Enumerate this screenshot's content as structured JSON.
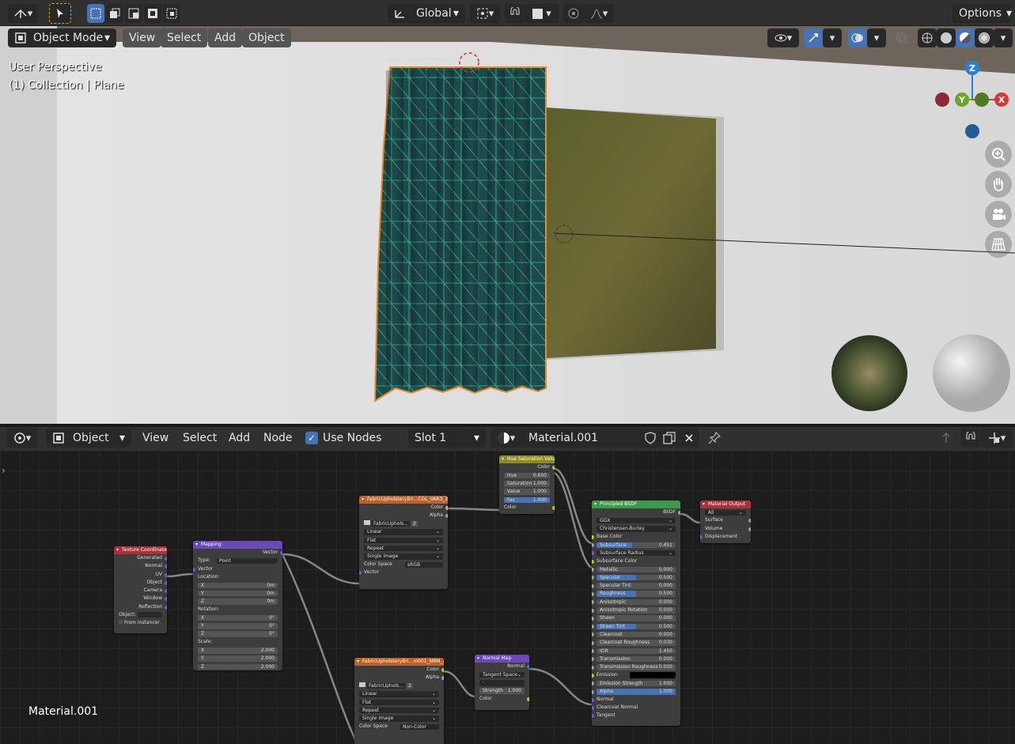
{
  "header": {
    "orientation": "Global",
    "options": "Options"
  },
  "viewport": {
    "mode": "Object Mode",
    "menus": [
      "View",
      "Select",
      "Add",
      "Object"
    ],
    "perspective": "User Perspective",
    "collection": "(1) Collection | Plane"
  },
  "gizmo": {
    "z": "Z",
    "y": "Y",
    "x": "X"
  },
  "node_editor": {
    "type": "Object",
    "menus": [
      "View",
      "Select",
      "Add",
      "Node"
    ],
    "use_nodes": "Use Nodes",
    "slot": "Slot 1",
    "material": "Material.001",
    "corner_label": "Material.001"
  },
  "nodes": {
    "texcoord": {
      "title": "Texture Coordinate",
      "outputs": [
        "Generated",
        "Normal",
        "UV",
        "Object",
        "Camera",
        "Window",
        "Reflection"
      ],
      "object": "Object:",
      "from_instancer": "From Instancer"
    },
    "mapping": {
      "title": "Mapping",
      "out": "Vector",
      "type_label": "Type:",
      "type": "Point",
      "vector": "Vector",
      "location": "Location:",
      "rotation": "Rotation:",
      "scale": "Scale:",
      "x": "X",
      "y": "Y",
      "z": "Z",
      "loc_vals": [
        "0m",
        "0m",
        "0m"
      ],
      "rot_vals": [
        "0°",
        "0°",
        "0°"
      ],
      "scale_vals": [
        "2.000",
        "2.000",
        "2.000"
      ]
    },
    "img1": {
      "title": "FabricUpholsteryBri...COL_VAR3_2K.jpg",
      "color": "Color",
      "alpha": "Alpha",
      "file": "FabricUphols...",
      "users": "2",
      "interp": "Linear",
      "proj": "Flat",
      "ext": "Repeat",
      "src": "Single Image",
      "cs_label": "Color Space",
      "cs": "sRGB",
      "vector": "Vector"
    },
    "hsv": {
      "title": "Hue Saturation Value",
      "color": "Color",
      "hue": "Hue",
      "hue_v": "0.600",
      "sat": "Saturation",
      "sat_v": "1.000",
      "val": "Value",
      "val_v": "1.000",
      "fac": "Fac",
      "fac_v": "1.000",
      "in_color": "Color"
    },
    "img2": {
      "title": "FabricUpholsteryBri...m001_NRM_2K.jpg",
      "color": "Color",
      "alpha": "Alpha",
      "file": "FabricUphols...",
      "users": "2",
      "interp": "Linear",
      "proj": "Flat",
      "ext": "Repeat",
      "src": "Single Image",
      "cs_label": "Color Space",
      "cs": "Non-Color"
    },
    "normalmap": {
      "title": "Normal Map",
      "out": "Normal",
      "space": "Tangent Space",
      "strength": "Strength",
      "strength_v": "1.000",
      "color": "Color"
    },
    "bsdf": {
      "title": "Principled BSDF",
      "out": "BSDF",
      "dist": "GGX",
      "sss": "Christensen-Burley",
      "rows": [
        [
          "Base Color",
          ""
        ],
        [
          "Subsurface",
          "0.451"
        ],
        [
          "Subsurface Radius",
          ""
        ],
        [
          "Subsurface Color",
          ""
        ],
        [
          "Metallic",
          "0.000"
        ],
        [
          "Specular",
          "0.500"
        ],
        [
          "Specular Tint",
          "0.000"
        ],
        [
          "Roughness",
          "0.500"
        ],
        [
          "Anisotropic",
          "0.000"
        ],
        [
          "Anisotropic Rotation",
          "0.000"
        ],
        [
          "Sheen",
          "0.000"
        ],
        [
          "Sheen Tint",
          "0.500"
        ],
        [
          "Clearcoat",
          "0.000"
        ],
        [
          "Clearcoat Roughness",
          "0.030"
        ],
        [
          "IOR",
          "1.450"
        ],
        [
          "Transmission",
          "0.000"
        ],
        [
          "Transmission Roughness",
          "0.000"
        ],
        [
          "Emission",
          ""
        ],
        [
          "Emission Strength",
          "1.000"
        ],
        [
          "Alpha",
          "1.000"
        ],
        [
          "Normal",
          ""
        ],
        [
          "Clearcoat Normal",
          ""
        ],
        [
          "Tangent",
          ""
        ]
      ]
    },
    "output": {
      "title": "Material Output",
      "target": "All",
      "surface": "Surface",
      "volume": "Volume",
      "displacement": "Displacement"
    }
  }
}
